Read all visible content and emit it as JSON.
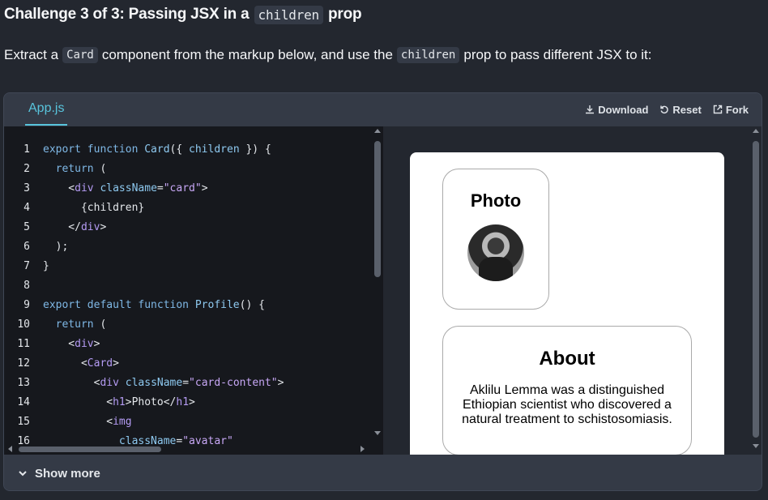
{
  "challenge": {
    "prefix": "Challenge 3 of 3:",
    "title_part1": "Passing JSX in a",
    "title_code": "children",
    "title_part2": "prop"
  },
  "description": {
    "part1": "Extract a",
    "code1": "Card",
    "part2": "component from the markup below, and use the",
    "code2": "children",
    "part3": "prop to pass different JSX to it:"
  },
  "sandbox": {
    "tab_label": "App.js",
    "actions": {
      "download": "Download",
      "reset": "Reset",
      "fork": "Fork"
    },
    "show_more": "Show more",
    "code_lines": [
      {
        "n": "1",
        "parts": [
          [
            "kw",
            "export function "
          ],
          [
            "fn",
            "Card"
          ],
          [
            "plain",
            "({ "
          ],
          [
            "attr",
            "children"
          ],
          [
            "plain",
            " }) {"
          ]
        ]
      },
      {
        "n": "2",
        "parts": [
          [
            "plain",
            "  "
          ],
          [
            "kw",
            "return"
          ],
          [
            "plain",
            " ("
          ]
        ]
      },
      {
        "n": "3",
        "parts": [
          [
            "plain",
            "    <"
          ],
          [
            "tag",
            "div"
          ],
          [
            "plain",
            " "
          ],
          [
            "attr",
            "className"
          ],
          [
            "plain",
            "="
          ],
          [
            "str",
            "\"card\""
          ],
          [
            "plain",
            ">"
          ]
        ]
      },
      {
        "n": "4",
        "parts": [
          [
            "plain",
            "      {children}"
          ]
        ]
      },
      {
        "n": "5",
        "parts": [
          [
            "plain",
            "    </"
          ],
          [
            "tag",
            "div"
          ],
          [
            "plain",
            ">"
          ]
        ]
      },
      {
        "n": "6",
        "parts": [
          [
            "plain",
            "  );"
          ]
        ]
      },
      {
        "n": "7",
        "parts": [
          [
            "plain",
            "}"
          ]
        ]
      },
      {
        "n": "8",
        "parts": [
          [
            "plain",
            ""
          ]
        ]
      },
      {
        "n": "9",
        "parts": [
          [
            "kw",
            "export default function "
          ],
          [
            "fn",
            "Profile"
          ],
          [
            "plain",
            "() {"
          ]
        ]
      },
      {
        "n": "10",
        "parts": [
          [
            "plain",
            "  "
          ],
          [
            "kw",
            "return"
          ],
          [
            "plain",
            " ("
          ]
        ]
      },
      {
        "n": "11",
        "parts": [
          [
            "plain",
            "    <"
          ],
          [
            "tag",
            "div"
          ],
          [
            "plain",
            ">"
          ]
        ]
      },
      {
        "n": "12",
        "parts": [
          [
            "plain",
            "      <"
          ],
          [
            "tag",
            "Card"
          ],
          [
            "plain",
            ">"
          ]
        ]
      },
      {
        "n": "13",
        "parts": [
          [
            "plain",
            "        <"
          ],
          [
            "tag",
            "div"
          ],
          [
            "plain",
            " "
          ],
          [
            "attr",
            "className"
          ],
          [
            "plain",
            "="
          ],
          [
            "str",
            "\"card-content\""
          ],
          [
            "plain",
            ">"
          ]
        ]
      },
      {
        "n": "14",
        "parts": [
          [
            "plain",
            "          <"
          ],
          [
            "tag",
            "h1"
          ],
          [
            "plain",
            ">Photo</"
          ],
          [
            "tag",
            "h1"
          ],
          [
            "plain",
            ">"
          ]
        ]
      },
      {
        "n": "15",
        "parts": [
          [
            "plain",
            "          <"
          ],
          [
            "tag",
            "img"
          ]
        ]
      },
      {
        "n": "16",
        "parts": [
          [
            "plain",
            "            "
          ],
          [
            "attr",
            "className"
          ],
          [
            "plain",
            "="
          ],
          [
            "str",
            "\"avatar\""
          ]
        ]
      }
    ]
  },
  "preview": {
    "card1_heading": "Photo",
    "card2_heading": "About",
    "card2_text": "Aklilu Lemma was a distinguished Ethiopian scientist who discovered a natural treatment to schistosomiasis."
  },
  "colors": {
    "background": "#23272f",
    "accent": "#58c4dc"
  }
}
